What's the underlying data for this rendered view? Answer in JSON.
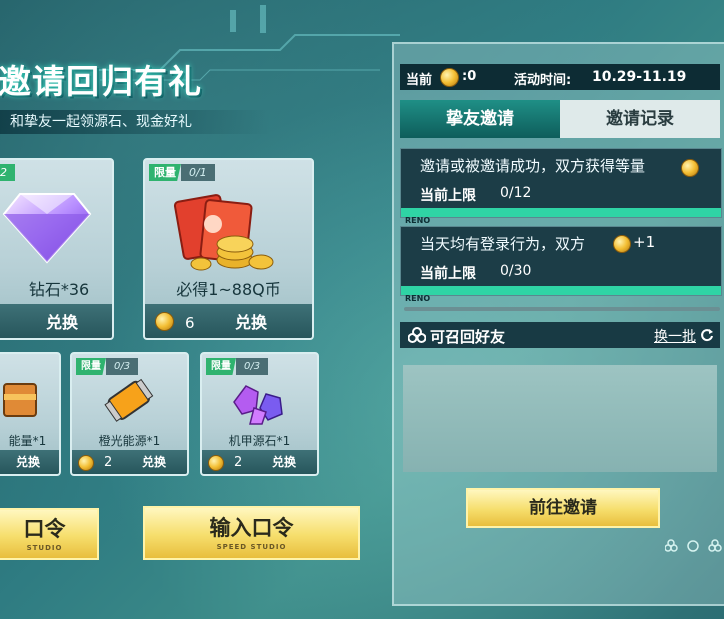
{
  "header": {
    "title": "邀请回归有礼",
    "subtitle": "和挚友一起领源石、现金好礼"
  },
  "rewards_top": [
    {
      "badge_limit": "",
      "badge_count": "2",
      "name": "钻石*36",
      "exchange_label": "兑换",
      "price": ""
    },
    {
      "badge_limit": "限量",
      "badge_count": "0/1",
      "name": "必得1~88Q币",
      "exchange_label": "兑换",
      "price": "6"
    }
  ],
  "rewards_bottom": [
    {
      "badge_limit": "",
      "badge_count": "",
      "name": "能量*1",
      "exchange_label": "兑换",
      "price": ""
    },
    {
      "badge_limit": "限量",
      "badge_count": "0/3",
      "name": "橙光能源*1",
      "exchange_label": "兑换",
      "price": "2"
    },
    {
      "badge_limit": "限量",
      "badge_count": "0/3",
      "name": "机甲源石*1",
      "exchange_label": "兑换",
      "price": "2"
    }
  ],
  "buttons": {
    "left_label": "口令",
    "left_sub": "STUDIO",
    "enter_code_label": "输入口令",
    "enter_code_sub": "SPEED STUDIO"
  },
  "panel": {
    "current_label": "当前",
    "current_value": ":0",
    "event_time_label": "活动时间:",
    "event_time_value": "10.29-11.19",
    "tabs": [
      "挚友邀请",
      "邀请记录"
    ],
    "tasks": [
      {
        "desc": "邀请或被邀请成功，双方获得等量",
        "limit_label": "当前上限",
        "limit_value": "0/12",
        "strip_logo": "RENO"
      },
      {
        "desc": "当天均有登录行为，双方",
        "bonus": "+1",
        "limit_label": "当前上限",
        "limit_value": "0/30",
        "strip_logo": "RENO"
      }
    ],
    "friends_title": "可召回好友",
    "refresh_label": "换一批",
    "goto_invite_label": "前往邀请"
  },
  "colors": {
    "accent_green": "#2fd4a5",
    "gold": "#f6de6c",
    "dark_panel": "#1c3d47"
  }
}
